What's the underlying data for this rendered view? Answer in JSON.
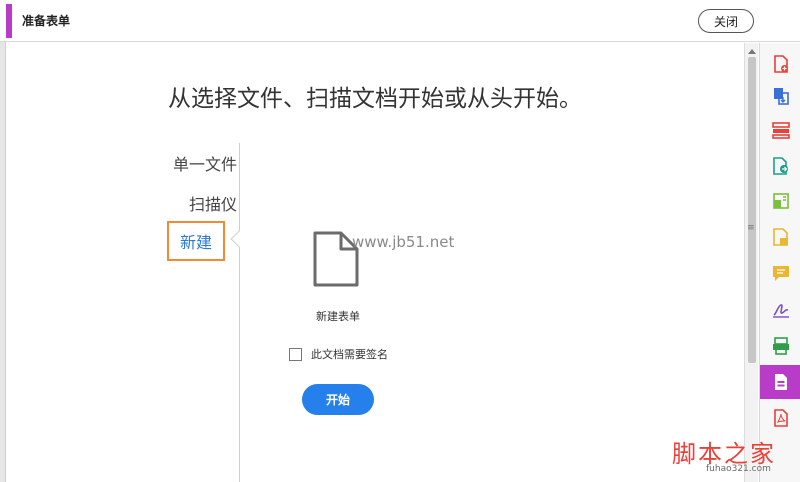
{
  "header": {
    "title": "准备表单",
    "close_label": "关闭",
    "accent_color": "#b93cc8"
  },
  "main": {
    "headline": "从选择文件、扫描文档开始或从头开始。",
    "nav": [
      {
        "label": "单一文件",
        "selected": false
      },
      {
        "label": "扫描仪",
        "selected": false
      },
      {
        "label": "新建",
        "selected": true
      }
    ],
    "new_form": {
      "icon": "document-icon",
      "label": "新建表单",
      "signature_checkbox": {
        "label": "此文档需要签名",
        "checked": false
      },
      "start_label": "开始",
      "start_color": "#2680eb"
    }
  },
  "watermark": {
    "url": "www.jb51.net"
  },
  "tools": [
    {
      "icon": "create-pdf-icon",
      "color": "#e8413a"
    },
    {
      "icon": "combine-files-icon",
      "color": "#3b6fd8"
    },
    {
      "icon": "organize-pages-icon",
      "color": "#e8413a"
    },
    {
      "icon": "export-pdf-icon",
      "color": "#1e9e8a"
    },
    {
      "icon": "edit-pdf-icon",
      "color": "#7bbf3a"
    },
    {
      "icon": "fill-sign-icon",
      "color": "#e8b830"
    },
    {
      "icon": "comment-icon",
      "color": "#e8b830"
    },
    {
      "icon": "signature-icon",
      "color": "#7a4fc8"
    },
    {
      "icon": "scan-enhance-icon",
      "color": "#2f9e4a"
    },
    {
      "icon": "prepare-form-icon",
      "color": "#ffffff",
      "active": true
    },
    {
      "icon": "pdf-file-icon",
      "color": "#e8413a"
    }
  ],
  "brand": {
    "name": "脚本之家",
    "url": "fuhao321.com"
  }
}
